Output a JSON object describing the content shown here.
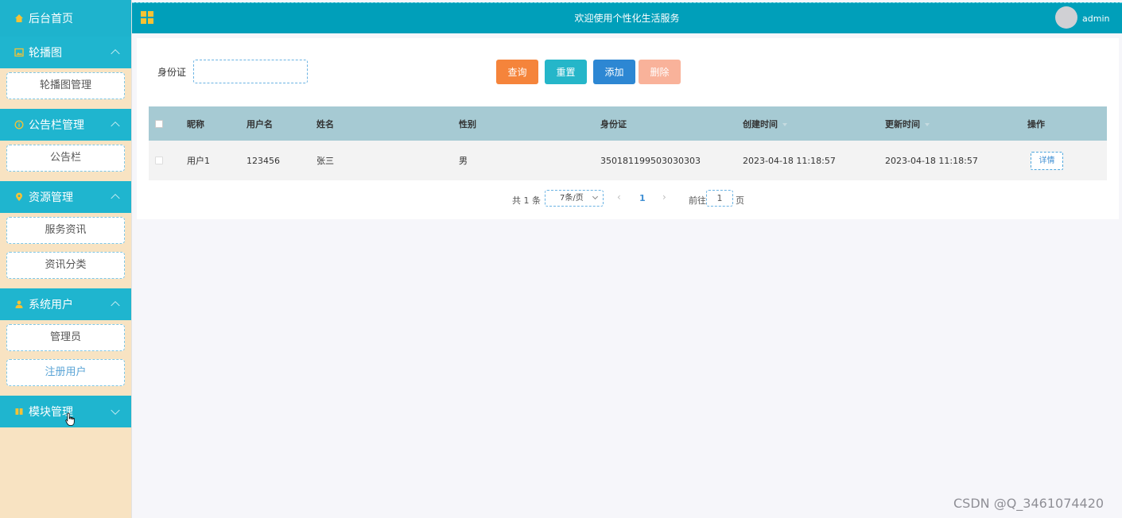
{
  "sidebar": {
    "home": "后台首页",
    "groups": [
      {
        "label": "轮播图",
        "items": [
          "轮播图管理"
        ]
      },
      {
        "label": "公告栏管理",
        "items": [
          "公告栏"
        ]
      },
      {
        "label": "资源管理",
        "items": [
          "服务资讯",
          "资讯分类"
        ]
      },
      {
        "label": "系统用户",
        "items": [
          "管理员",
          "注册用户"
        ]
      },
      {
        "label": "模块管理",
        "items": []
      }
    ]
  },
  "header": {
    "title": "欢迎使用个性化生活服务",
    "user": "admin"
  },
  "search": {
    "label": "身份证",
    "value": "",
    "buttons": {
      "query": "查询",
      "reset": "重置",
      "add": "添加",
      "delete": "删除"
    }
  },
  "table": {
    "columns": [
      "昵称",
      "用户名",
      "姓名",
      "性别",
      "身份证",
      "创建时间",
      "更新时间",
      "操作"
    ],
    "rows": [
      {
        "nickname": "用户1",
        "username": "123456",
        "name": "张三",
        "gender": "男",
        "idcard": "350181199503030303",
        "created": "2023-04-18 11:18:57",
        "updated": "2023-04-18 11:18:57",
        "action": "详情"
      }
    ]
  },
  "pager": {
    "total": "共 1 条",
    "size": "7条/页",
    "current": "1",
    "goto_label": "前往",
    "goto_value": "1",
    "page_unit": "页"
  },
  "watermark": "CSDN @Q_3461074420",
  "colors": {
    "sidebar_head": "#1fb5cf",
    "sidebar_bg": "#f8e3c2",
    "header": "#009fba",
    "btn_query": "#f5843b",
    "btn_reset": "#25b6c9",
    "btn_add": "#2d87d3",
    "btn_delete": "#f9b29a",
    "table_head": "#a6cad3"
  }
}
